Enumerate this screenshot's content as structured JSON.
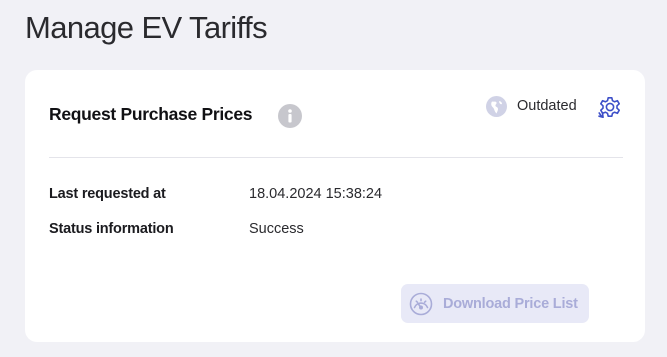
{
  "page": {
    "title": "Manage EV Tariffs"
  },
  "card": {
    "title": "Request Purchase Prices",
    "info_icon": "info-icon",
    "status": {
      "text": "Outdated",
      "icon": "globe-status-icon",
      "color": "#d0d2e6"
    },
    "settings_icon": "gear-icon",
    "rows": [
      {
        "label": "Last requested at",
        "value": "18.04.2024 15:38:24"
      },
      {
        "label": "Status information",
        "value": "Success"
      }
    ],
    "download_button": {
      "label": "Download Price List",
      "icon": "gauge-icon",
      "disabled": true
    }
  },
  "colors": {
    "background": "#f1f1f6",
    "card": "#ffffff",
    "accent": "#3d4fc8",
    "button_bg": "#e8e9f7",
    "button_text": "#a9acd8"
  }
}
